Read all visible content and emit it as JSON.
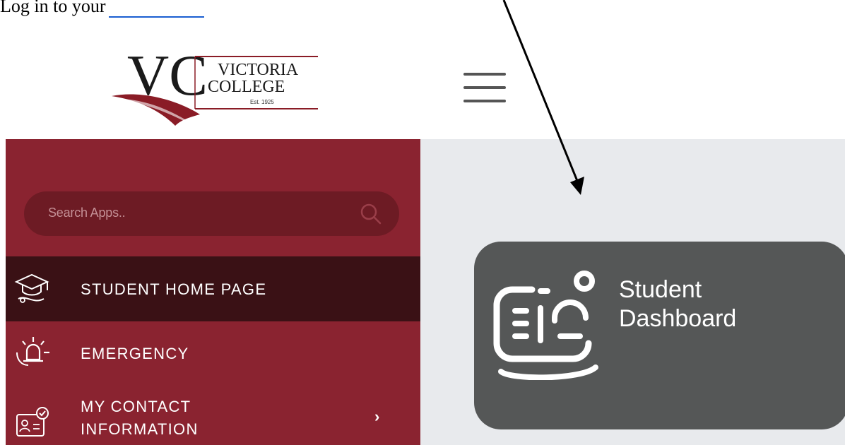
{
  "document": {
    "line_text": "Log in to your",
    "link_color": "#1a5ed1"
  },
  "logo": {
    "line1": "VICTORIA",
    "line2": "COLLEGE",
    "established": "Est. 1925",
    "monogram": "VC"
  },
  "header": {
    "menu_icon": "hamburger-icon"
  },
  "sidebar": {
    "background": "#8a2330",
    "search": {
      "placeholder": "Search Apps.."
    },
    "items": [
      {
        "label": "STUDENT HOME PAGE",
        "icon": "graduation-cap-icon",
        "active": true
      },
      {
        "label": "EMERGENCY",
        "icon": "emergency-alarm-icon",
        "active": false
      },
      {
        "label_line1": "MY CONTACT",
        "label_line2": "INFORMATION",
        "icon": "contact-card-icon",
        "active": false,
        "chevron": "›"
      }
    ]
  },
  "main": {
    "background": "#e8eaed",
    "tile": {
      "title_line1": "Student",
      "title_line2": "Dashboard",
      "icon": "dashboard-icon",
      "background": "#555757"
    }
  }
}
